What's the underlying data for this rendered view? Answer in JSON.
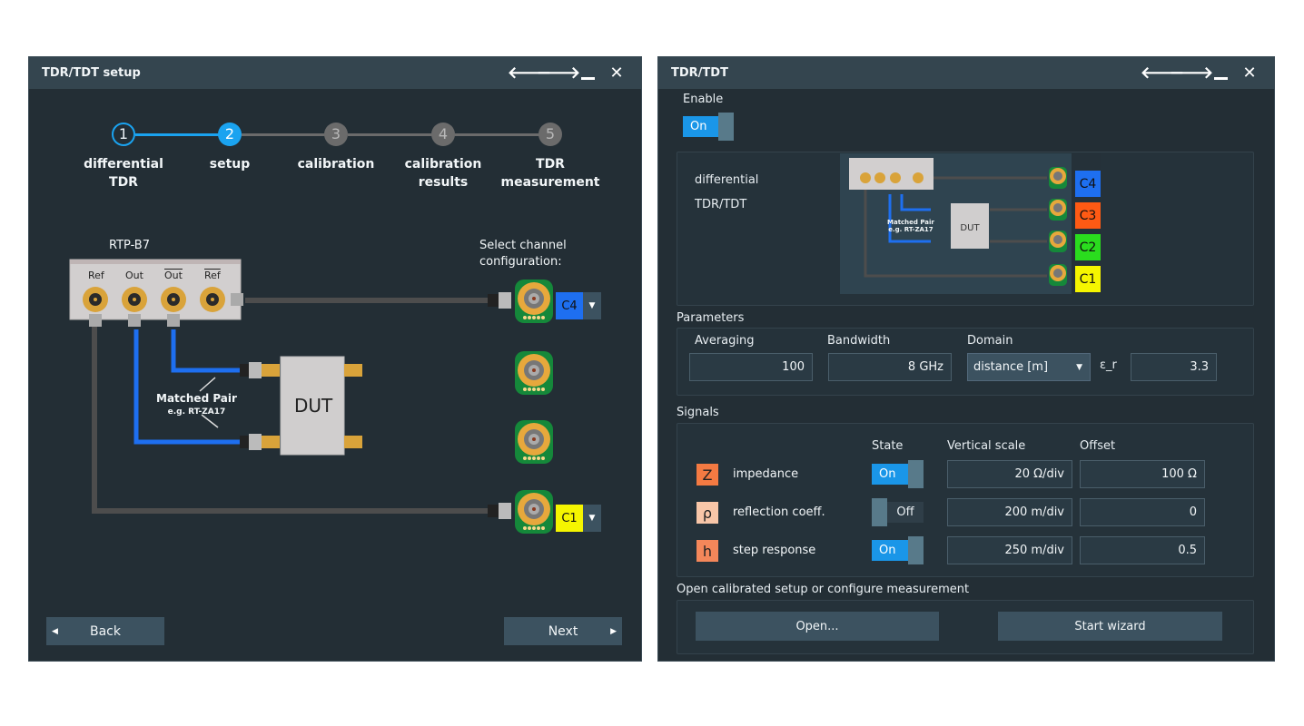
{
  "left_window": {
    "title": "TDR/TDT setup",
    "window_icons": [
      "back-arrow-icon",
      "forward-arrow-icon",
      "minimize-icon",
      "close-icon"
    ],
    "steps": [
      {
        "number": "1",
        "label_line1": "differential",
        "label_line2": "TDR",
        "state": "done"
      },
      {
        "number": "2",
        "label_line1": "setup",
        "label_line2": "",
        "state": "active"
      },
      {
        "number": "3",
        "label_line1": "calibration",
        "label_line2": "",
        "state": "todo"
      },
      {
        "number": "4",
        "label_line1": "calibration",
        "label_line2": "results",
        "state": "todo"
      },
      {
        "number": "5",
        "label_line1": "TDR",
        "label_line2": "measurement",
        "state": "todo"
      }
    ],
    "module_name": "RTP-B7",
    "ports": [
      "Ref",
      "Out",
      "Out",
      "Ref"
    ],
    "ports_overlined": [
      false,
      false,
      true,
      true
    ],
    "select_label_line1": "Select channel",
    "select_label_line2": "configuration:",
    "matched_pair_line1": "Matched Pair",
    "matched_pair_line2": "e.g. RT-ZA17",
    "dut_label": "DUT",
    "channel_top": {
      "label": "C4",
      "color": "#1e6ff0"
    },
    "channel_bottom": {
      "label": "C1",
      "color": "#f5f500"
    },
    "back_label": "Back",
    "next_label": "Next"
  },
  "right_window": {
    "title": "TDR/TDT",
    "window_icons": [
      "back-arrow-icon",
      "forward-arrow-icon",
      "minimize-icon",
      "close-icon"
    ],
    "enable_label": "Enable",
    "enable_state": "On",
    "mode_line1": "differential",
    "mode_line2": "TDR/TDT",
    "mini_dut_label": "DUT",
    "mini_matched_pair_line1": "Matched Pair",
    "mini_matched_pair_line2": "e.g. RT-ZA17",
    "channels": [
      {
        "label": "C4",
        "color": "#1e6ff0"
      },
      {
        "label": "C3",
        "color": "#ff5a14"
      },
      {
        "label": "C2",
        "color": "#2adc1e"
      },
      {
        "label": "C1",
        "color": "#f5f500"
      }
    ],
    "parameters": {
      "title": "Parameters",
      "averaging_label": "Averaging",
      "averaging_value": "100",
      "bandwidth_label": "Bandwidth",
      "bandwidth_value": "8 GHz",
      "domain_label": "Domain",
      "domain_value": "distance [m]",
      "epsilon_label": "ε_r",
      "epsilon_value": "3.3"
    },
    "signals": {
      "title": "Signals",
      "col_state": "State",
      "col_vscale": "Vertical scale",
      "col_offset": "Offset",
      "rows": [
        {
          "symbol": "Z",
          "name": "impedance",
          "state": "On",
          "vscale": "20 Ω/div",
          "offset": "100 Ω",
          "icon_color": "#f47a42"
        },
        {
          "symbol": "ρ",
          "name": "reflection coeff.",
          "state": "Off",
          "vscale": "200 m/div",
          "offset": "0",
          "icon_color": "#f8c6a8"
        },
        {
          "symbol": "h",
          "name": "step response",
          "state": "On",
          "vscale": "250 m/div",
          "offset": "0.5",
          "icon_color": "#f4875a"
        }
      ]
    },
    "open_section": {
      "title": "Open calibrated setup or configure measurement",
      "open_label": "Open...",
      "wizard_label": "Start wizard"
    }
  }
}
